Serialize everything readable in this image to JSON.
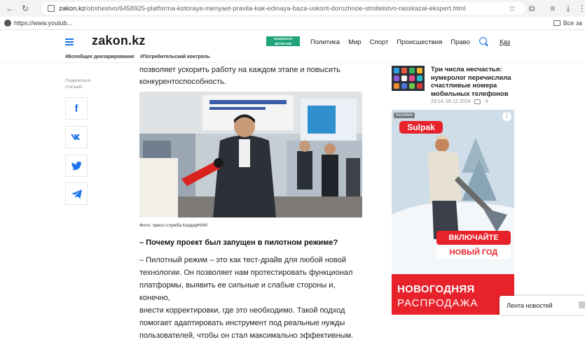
{
  "browser": {
    "url_host": "zakon.kz",
    "url_path": "/obshestvo/6458925-platforma-kotoraya-menyaet-pravila-kak-edinaya-baza-uskorit-dorozhnoe-stroitelstvo-rasskazal-ekspert.html",
    "bookmark": "https://www.youtub...",
    "bookmarks_folder": "Все за"
  },
  "header": {
    "logo": "zakon.kz",
    "promo": "НАЦИОНАЛ ДЕТЕКТИВ",
    "menu": [
      "Политика",
      "Мир",
      "Спорт",
      "Происшествия",
      "Право"
    ],
    "lang": "Қаз"
  },
  "tags": [
    "#Всеобщее декларирование",
    "#Потребительский контроль"
  ],
  "share": {
    "label": "Поделиться статьей:",
    "buttons": [
      "f",
      "vk",
      "tw",
      "tg"
    ]
  },
  "article": {
    "intro_line1": "позволяет ускорить работу на каждом этапе и повысить",
    "intro_line2": "конкурентоспособность.",
    "photo_caption": "Фото: пресс-служба КаздорНИИ",
    "question": "– Почему проект был запущен в пилотном режиме?",
    "answer_lines": [
      "– Пилотный режим – это как тест-драйв для любой новой",
      "технологии. Он позволяет нам протестировать функционал",
      "платформы, выявить ее сильные и слабые стороны и, конечно,",
      "внести корректировки, где это необходимо. Такой подход",
      "помогает адаптировать инструмент под реальные нужды",
      "пользователей, чтобы он стал максимально эффективным."
    ]
  },
  "sidebar": {
    "news_title": "Три числа несчастья: нумеролог перечислила счастливые номера мобильных телефонов",
    "news_time": "23:14, 05.12.2024",
    "news_comments": "0",
    "ad": {
      "badge": "РЕКЛАМА",
      "brand": "Sulpak",
      "btn1": "ВКЛЮЧАЙТЕ",
      "btn2": "НОВЫЙ ГОД",
      "bottom1": "НОВОГОДНЯЯ",
      "bottom2": "РАСПРОДАЖА"
    }
  },
  "feed_tab": "Лента новостей"
}
